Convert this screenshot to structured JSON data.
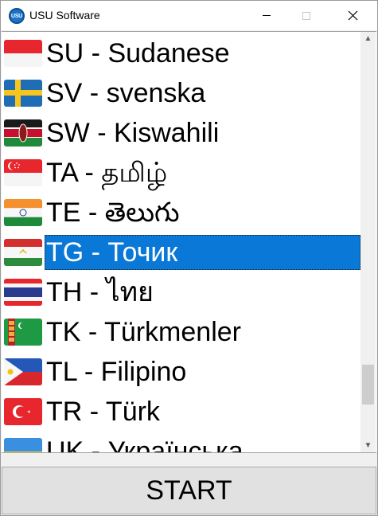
{
  "window": {
    "title": "USU Software",
    "icon_text": "USU"
  },
  "languages": [
    {
      "label": "SU - Sudanese",
      "flag": "flag-indonesia",
      "selected": false
    },
    {
      "label": "SV - svenska",
      "flag": "flag-sweden",
      "selected": false
    },
    {
      "label": "SW - Kiswahili",
      "flag": "flag-kenya",
      "selected": false
    },
    {
      "label": "TA - தமிழ்",
      "flag": "flag-singapore",
      "selected": false
    },
    {
      "label": "TE - తెలుగు",
      "flag": "flag-india",
      "selected": false
    },
    {
      "label": "TG - Точик",
      "flag": "flag-tajikistan",
      "selected": true
    },
    {
      "label": "TH - ไทย",
      "flag": "flag-thailand",
      "selected": false
    },
    {
      "label": "TK - Türkmenler",
      "flag": "flag-turkmenistan",
      "selected": false
    },
    {
      "label": "TL - Filipino",
      "flag": "flag-philippines",
      "selected": false
    },
    {
      "label": "TR - Türk",
      "flag": "flag-turkey",
      "selected": false
    },
    {
      "label": "UK - Українська",
      "flag": "flag-ukraine",
      "selected": false
    }
  ],
  "start_button": {
    "label": "START"
  },
  "colors": {
    "selection": "#0a78d7"
  }
}
